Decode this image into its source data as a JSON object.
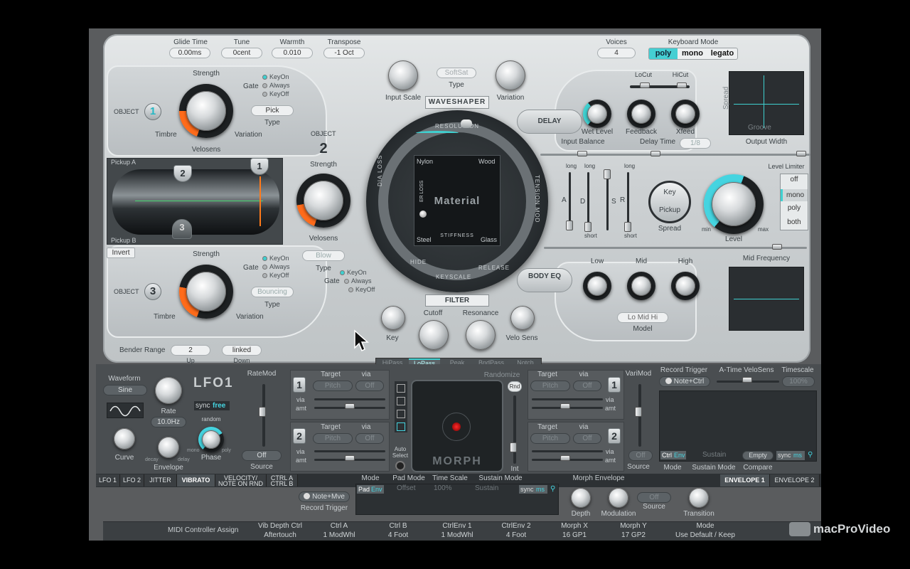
{
  "top": {
    "glide_time": {
      "label": "Glide Time",
      "value": "0.00ms"
    },
    "tune": {
      "label": "Tune",
      "value": "0cent"
    },
    "warmth": {
      "label": "Warmth",
      "value": "0.010"
    },
    "transpose": {
      "label": "Transpose",
      "value": "-1 Oct"
    },
    "voices": {
      "label": "Voices",
      "value": "4"
    },
    "keyboard_mode": {
      "label": "Keyboard Mode",
      "options": [
        "poly",
        "mono",
        "legato"
      ],
      "selected": "poly"
    }
  },
  "objects": {
    "object_label": "OBJECT",
    "o1": {
      "num": "1",
      "strength": "Strength",
      "timbre": "Timbre",
      "variation": "Variation",
      "velosens": "Velosens",
      "gate": "Gate",
      "gate_opts": [
        "KeyOn",
        "Always",
        "KeyOff"
      ],
      "type_value": "Pick",
      "type_label": "Type"
    },
    "o2": {
      "num": "2",
      "strength": "Strength",
      "velosens": "Velosens",
      "type_value": "Blow",
      "type_label": "Type",
      "gate": "Gate",
      "gate_opts": [
        "KeyOn",
        "Always",
        "KeyOff"
      ]
    },
    "o3": {
      "num": "3",
      "strength": "Strength",
      "timbre": "Timbre",
      "variation": "Variation",
      "gate": "Gate",
      "gate_opts": [
        "KeyOn",
        "Always",
        "KeyOff"
      ],
      "type_value": "Bouncing",
      "type_label": "Type"
    }
  },
  "pickup": {
    "a": "Pickup A",
    "b": "Pickup B",
    "invert": "Invert",
    "markers": [
      "1",
      "2",
      "3"
    ]
  },
  "waveshaper": {
    "input_scale": "Input Scale",
    "softsat": "SoftSat",
    "type": "Type",
    "variation": "Variation",
    "title": "WAVESHAPER"
  },
  "material": {
    "title": "Material",
    "resolution": "RESOLUTION",
    "nylon": "Nylon",
    "wood": "Wood",
    "steel": "Steel",
    "glass": "Glass",
    "stiffness": "STIFFNESS",
    "inner_loss": "ER LOSS",
    "media_loss": "DIA LOSS",
    "tension_mod": "TENSION MOD",
    "hide": "HIDE",
    "keyscale": "KEYSCALE",
    "release": "RELEASE"
  },
  "filter": {
    "title": "FILTER",
    "key": "Key",
    "cutoff": "Cutoff",
    "resonance": "Resonance",
    "velo_sens": "Velo Sens",
    "modes": [
      "HiPass",
      "LoPass",
      "Peak",
      "BndPass",
      "Notch"
    ],
    "selected": "LoPass"
  },
  "bender": {
    "label": "Bender Range",
    "up_value": "2",
    "up": "Up",
    "down_value": "linked",
    "down": "Down"
  },
  "delay": {
    "title": "DELAY",
    "wet_level": "Wet Level",
    "feedback": "Feedback",
    "xfeed": "Xfeed",
    "locut": "LoCut",
    "hicut": "HiCut",
    "input_balance": "Input Balance",
    "delay_time": "Delay Time",
    "delay_value": "1/8",
    "output_width": "Output Width",
    "groove": "Groove",
    "spread": "Spread"
  },
  "env": {
    "long": "long",
    "short": "short",
    "a": "A",
    "d": "D",
    "s": "S",
    "r": "R"
  },
  "spread": {
    "key": "Key",
    "pickup": "Pickup",
    "label": "Spread"
  },
  "level": {
    "label": "Level",
    "min": "min",
    "max": "max",
    "limiter": "Level Limiter",
    "options": [
      "off",
      "mono",
      "poly",
      "both"
    ],
    "selected": "mono"
  },
  "body_eq": {
    "title": "BODY EQ",
    "low": "Low",
    "mid": "Mid",
    "high": "High",
    "mid_frequency": "Mid Frequency",
    "model_value": "Lo Mid Hi",
    "model": "Model"
  },
  "lfo": {
    "waveform": "Waveform",
    "waveform_value": "Sine",
    "title": "LFO1",
    "rate": "Rate",
    "rate_value": "10.0Hz",
    "sync": "sync",
    "free": "free",
    "curve": "Curve",
    "envelope": "Envelope",
    "phase": "Phase",
    "random": "random",
    "mono": "mono",
    "poly": "poly",
    "decay": "decay",
    "delay": "delay"
  },
  "ratemod": {
    "label": "RateMod",
    "source_value": "Off",
    "source": "Source"
  },
  "targets": {
    "target": "Target",
    "via": "via",
    "amt": "amt",
    "pitch": "Pitch",
    "off": "Off"
  },
  "morph_pad": {
    "title": "MORPH",
    "randomize": "Randomize",
    "auto_select": "Auto Select",
    "rnd": "Rnd",
    "int": "Int"
  },
  "varimod": {
    "label": "VariMod",
    "source_value": "Off",
    "source": "Source"
  },
  "record": {
    "trigger": "Record Trigger",
    "trigger_value": "Note+Ctrl",
    "a_time": "A-Time VeloSens",
    "timescale": "Timescale",
    "timescale_value": "100%",
    "ctrl": "Ctrl",
    "env": "Env",
    "sustain": "Sustain",
    "empty": "Empty",
    "sync": "sync",
    "ms": "ms",
    "mode": "Mode",
    "sustain_mode": "Sustain Mode",
    "compare": "Compare"
  },
  "tabs": {
    "items": [
      "LFO 1",
      "LFO 2",
      "JITTER",
      "VIBRATO",
      "VELOCITY/ NOTE ON RND",
      "CTRL A CTRL B"
    ],
    "selected": "VIBRATO",
    "env_tabs": [
      "ENVELOPE 1",
      "ENVELOPE 2"
    ]
  },
  "morph_env": {
    "record_trigger": "Record Trigger",
    "rt_value": "Note+Mve",
    "mode": "Mode",
    "pad_mode": "Pad Mode",
    "time_scale": "Time Scale",
    "sustain_mode": "Sustain Mode",
    "pad": "Pad",
    "env": "Env",
    "offset": "Offset",
    "percent": "100%",
    "sustain": "Sustain",
    "sync": "sync",
    "ms": "ms",
    "title": "Morph Envelope",
    "depth": "Depth",
    "modulation": "Modulation",
    "source_value": "Off",
    "source": "Source",
    "transition": "Transition"
  },
  "midi": {
    "label": "MIDI Controller Assign",
    "cols": [
      {
        "name": "Vib Depth Ctrl",
        "value": "Aftertouch"
      },
      {
        "name": "Ctrl A",
        "value": "1 ModWhl"
      },
      {
        "name": "Ctrl B",
        "value": "4 Foot"
      },
      {
        "name": "CtrlEnv 1",
        "value": "1 ModWhl"
      },
      {
        "name": "CtrlEnv 2",
        "value": "4 Foot"
      },
      {
        "name": "Morph X",
        "value": "16 GP1"
      },
      {
        "name": "Morph Y",
        "value": "17 GP2"
      },
      {
        "name": "Mode",
        "value": "Use Default / Keep"
      }
    ]
  },
  "brand": "macProVideo"
}
